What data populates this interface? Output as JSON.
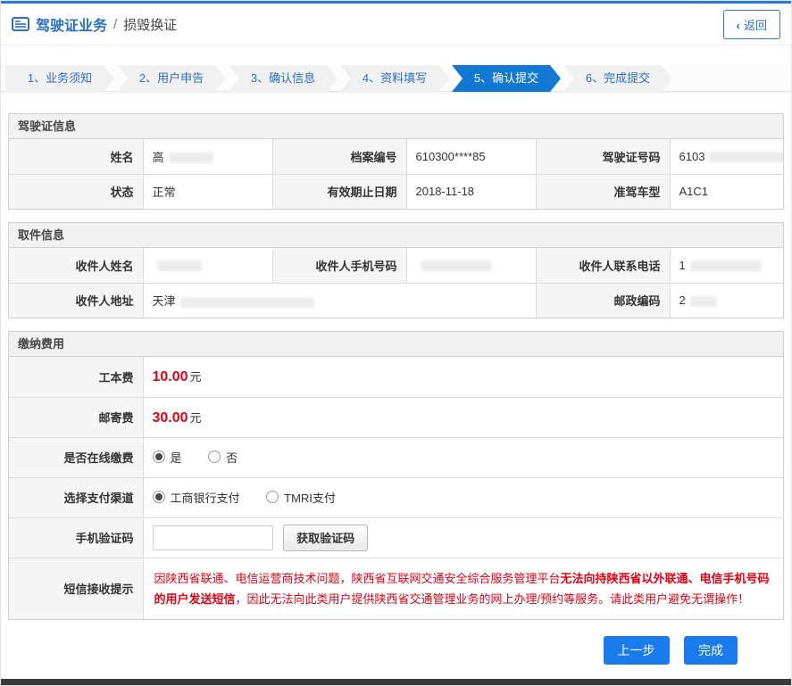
{
  "colors": {
    "accent_blue": "#1377d4",
    "link_blue": "#2a6fc9",
    "danger_red": "#e60012"
  },
  "header": {
    "title": "驾驶证业务",
    "separator": "/",
    "subtitle": "损毁换证",
    "back_arrow": "‹",
    "back_label": "返回"
  },
  "steps": [
    {
      "label": "1、业务须知",
      "active": false
    },
    {
      "label": "2、用户申告",
      "active": false
    },
    {
      "label": "3、确认信息",
      "active": false
    },
    {
      "label": "4、资料填写",
      "active": false
    },
    {
      "label": "5、确认提交",
      "active": true
    },
    {
      "label": "6、完成提交",
      "active": false
    }
  ],
  "license": {
    "section_title": "驾驶证信息",
    "name_label": "姓名",
    "name_value": "高",
    "file_no_label": "档案编号",
    "file_no_value": "610300****85",
    "license_no_label": "驾驶证号码",
    "license_no_value": "6103",
    "status_label": "状态",
    "status_value": "正常",
    "expiry_label": "有效期止日期",
    "expiry_value": "2018-11-18",
    "vehicle_class_label": "准驾车型",
    "vehicle_class_value": "A1C1"
  },
  "pickup": {
    "section_title": "取件信息",
    "recipient_name_label": "收件人姓名",
    "recipient_name_value": "",
    "recipient_mobile_label": "收件人手机号码",
    "recipient_mobile_value": "",
    "recipient_phone_label": "收件人联系电话",
    "recipient_phone_value": "1",
    "recipient_address_label": "收件人地址",
    "recipient_address_value": "天津",
    "postcode_label": "邮政编码",
    "postcode_value": "2"
  },
  "fees": {
    "section_title": "缴纳费用",
    "cost_label": "工本费",
    "cost_amount": "10.00",
    "cost_unit": "元",
    "postage_label": "邮寄费",
    "postage_amount": "30.00",
    "postage_unit": "元",
    "online_pay_label": "是否在线缴费",
    "online_pay_yes": "是",
    "online_pay_no": "否",
    "online_pay_selected": "是",
    "channel_label": "选择支付渠道",
    "channel_icbc": "工商银行支付",
    "channel_tmri": "TMRI支付",
    "channel_selected": "工商银行支付",
    "sms_code_label": "手机验证码",
    "sms_code_value": "",
    "get_code_button": "获取验证码",
    "notice_label": "短信接收提示",
    "notice_part1": "因陕西省联通、电信运营商技术问题，陕西省互联网交通安全综合服务管理平台",
    "notice_part2": "无法向持陕西省以外联通、电信手机号码的用户发送短信",
    "notice_part3": "，因此无法向此类用户提供陕西省交通管理业务的网上办理/预约等服务。请此类用户避免无谓操作！"
  },
  "actions": {
    "prev_label": "上一步",
    "finish_label": "完成"
  }
}
